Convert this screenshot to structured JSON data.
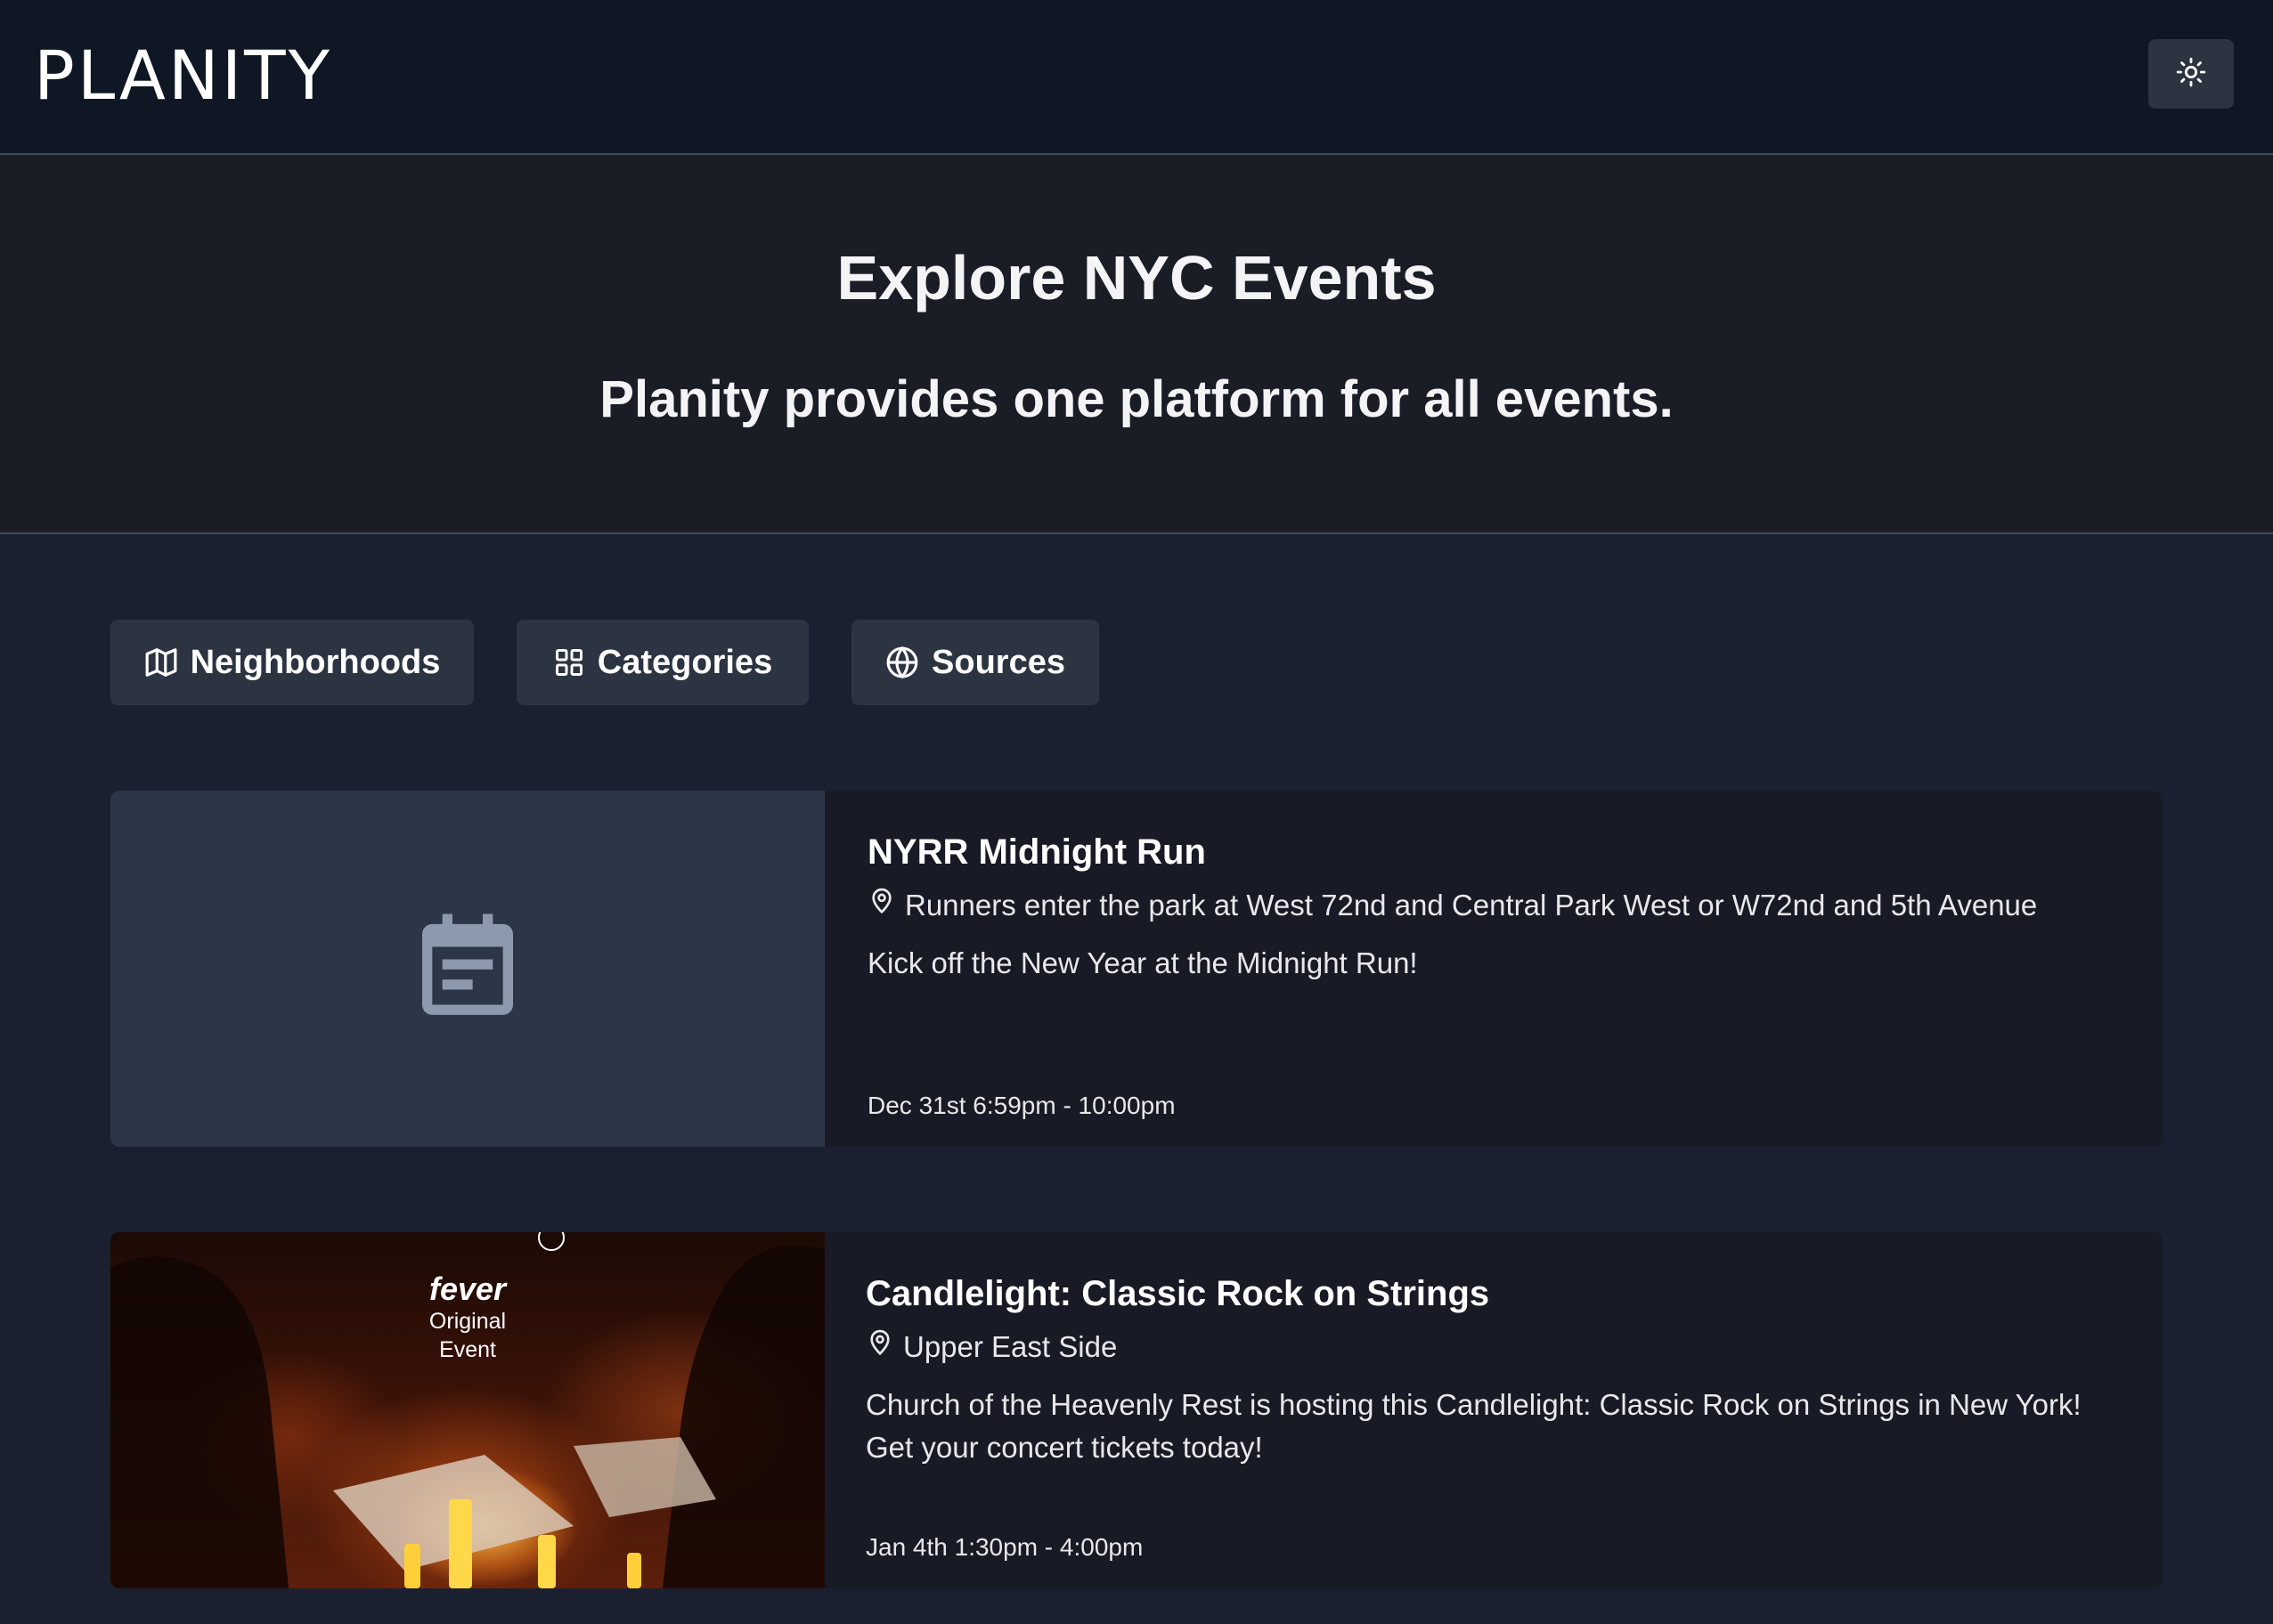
{
  "header": {
    "logo": "PLANITY",
    "theme_toggle_icon": "sun-icon"
  },
  "hero": {
    "title": "Explore NYC Events",
    "subtitle": "Planity provides one platform for all events."
  },
  "filters": [
    {
      "label": "Neighborhoods",
      "icon": "map-icon"
    },
    {
      "label": "Categories",
      "icon": "grid-icon"
    },
    {
      "label": "Sources",
      "icon": "globe-icon"
    }
  ],
  "events": [
    {
      "title": "NYRR Midnight Run",
      "location": "Runners enter the park at West 72nd and Central Park West or W72nd and 5th Avenue",
      "description": "Kick off the New Year at the Midnight Run!",
      "time": "Dec 31st 6:59pm - 10:00pm",
      "image": "calendar-placeholder-icon"
    },
    {
      "title": "Candlelight: Classic Rock on Strings",
      "location": "Upper East Side",
      "description": "Church of the Heavenly Rest is hosting this Candlelight: Classic Rock on Strings in New York! Get your concert tickets today!",
      "time": "Jan 4th 1:30pm - 4:00pm",
      "image": "event-photo",
      "image_overlay": {
        "brand": "fever",
        "line1": "Original",
        "line2": "Event"
      }
    }
  ],
  "colors": {
    "header_bg": "#0f1724",
    "hero_bg": "#1a1c26",
    "page_bg": "#1b2030",
    "button_bg": "#2c3442",
    "card_bg": "#181a25",
    "placeholder_bg": "#2d3648",
    "placeholder_icon": "#8d9aae"
  }
}
